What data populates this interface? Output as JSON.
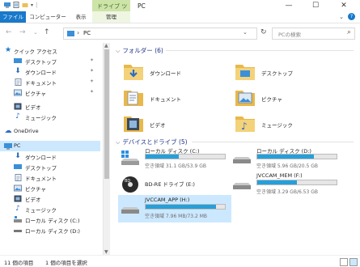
{
  "window": {
    "title": "PC",
    "context_tab": "ドライブ ツール",
    "buttons": {
      "minimize": "—",
      "maximize": "☐",
      "close": "✕"
    }
  },
  "ribbon": {
    "tabs": [
      "ファイル",
      "コンピューター",
      "表示",
      "管理"
    ],
    "help": "?"
  },
  "address": {
    "path": "PC",
    "search_placeholder": "PCの検索"
  },
  "nav": {
    "quick_access": "クイック アクセス",
    "quick_items": [
      {
        "label": "デスクトップ",
        "icon": "desktop-icon"
      },
      {
        "label": "ダウンロード",
        "icon": "download-icon"
      },
      {
        "label": "ドキュメント",
        "icon": "documents-icon"
      },
      {
        "label": "ピクチャ",
        "icon": "pictures-icon"
      },
      {
        "label": "ビデオ",
        "icon": "videos-icon"
      },
      {
        "label": "ミュージック",
        "icon": "music-icon"
      }
    ],
    "onedrive": "OneDrive",
    "pc": "PC",
    "pc_items": [
      {
        "label": "ダウンロード",
        "icon": "download-icon"
      },
      {
        "label": "デスクトップ",
        "icon": "desktop-icon"
      },
      {
        "label": "ドキュメント",
        "icon": "documents-icon"
      },
      {
        "label": "ピクチャ",
        "icon": "pictures-icon"
      },
      {
        "label": "ビデオ",
        "icon": "videos-icon"
      },
      {
        "label": "ミュージック",
        "icon": "music-icon"
      },
      {
        "label": "ローカル ディスク (C:)",
        "icon": "drive-c-icon"
      },
      {
        "label": "ローカル ディスク (D:)",
        "icon": "drive-icon"
      }
    ]
  },
  "folders": {
    "header": "フォルダー (6)",
    "items": [
      "ダウンロード",
      "デスクトップ",
      "ドキュメント",
      "ピクチャ",
      "ビデオ",
      "ミュージック"
    ]
  },
  "drives": {
    "header": "デバイスとドライブ (5)",
    "items": [
      {
        "name": "ローカル ディスク (C:)",
        "free": "空き領域 31.1 GB/53.9 GB",
        "used_fraction": 0.42
      },
      {
        "name": "ローカル ディスク (D:)",
        "free": "空き領域 5.96 GB/20.5 GB",
        "used_fraction": 0.71
      },
      {
        "name": "BD-RE ドライブ (E:)",
        "free": "",
        "used_fraction": null
      },
      {
        "name": "JVCCAM_MEM (F:)",
        "free": "空き領域 3.29 GB/6.53 GB",
        "used_fraction": 0.5
      },
      {
        "name": "JVCCAM_APP (H:)",
        "free": "空き領域 7.96 MB/73.2 MB",
        "used_fraction": 0.89
      }
    ]
  },
  "status": {
    "count": "11 個の項目",
    "selected": "1 個の項目を選択"
  },
  "colors": {
    "accent": "#1979ca",
    "selection": "#cce8ff",
    "bar_fill": "#26a0da",
    "context_tab": "#cde3a8"
  }
}
